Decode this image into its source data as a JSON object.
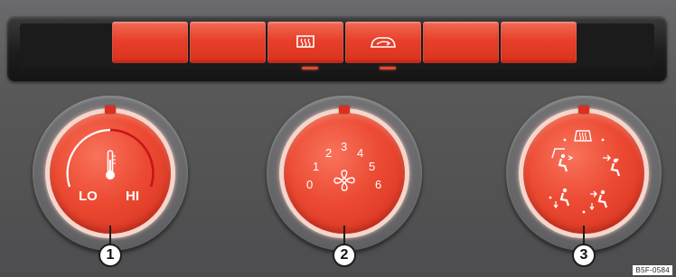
{
  "top_bar": {
    "buttons": [
      {
        "icon": "",
        "led": false
      },
      {
        "icon": "",
        "led": false
      },
      {
        "icon": "rear-window-defrost-icon",
        "led": true
      },
      {
        "icon": "air-recirculation-icon",
        "led": true
      },
      {
        "icon": "",
        "led": false
      },
      {
        "icon": "",
        "led": false
      }
    ]
  },
  "knobs": {
    "temperature": {
      "low_label": "LO",
      "high_label": "HI",
      "icon": "thermometer-icon",
      "callout": "1"
    },
    "fan": {
      "speeds": [
        "0",
        "1",
        "2",
        "3",
        "4",
        "5",
        "6"
      ],
      "icon": "fan-icon",
      "callout": "2"
    },
    "air_distribution": {
      "icons": [
        "windscreen-defrost-icon",
        "windscreen-and-footwell-icon",
        "upper-body-vent-icon",
        "footwell-vent-icon",
        "upper-body-and-footwell-icon"
      ],
      "callout": "3"
    }
  },
  "colors": {
    "accent": "#e8402a",
    "panel": "#5b5b5d",
    "bar": "#1d1d1d"
  },
  "reference_code": "B5F-0584"
}
